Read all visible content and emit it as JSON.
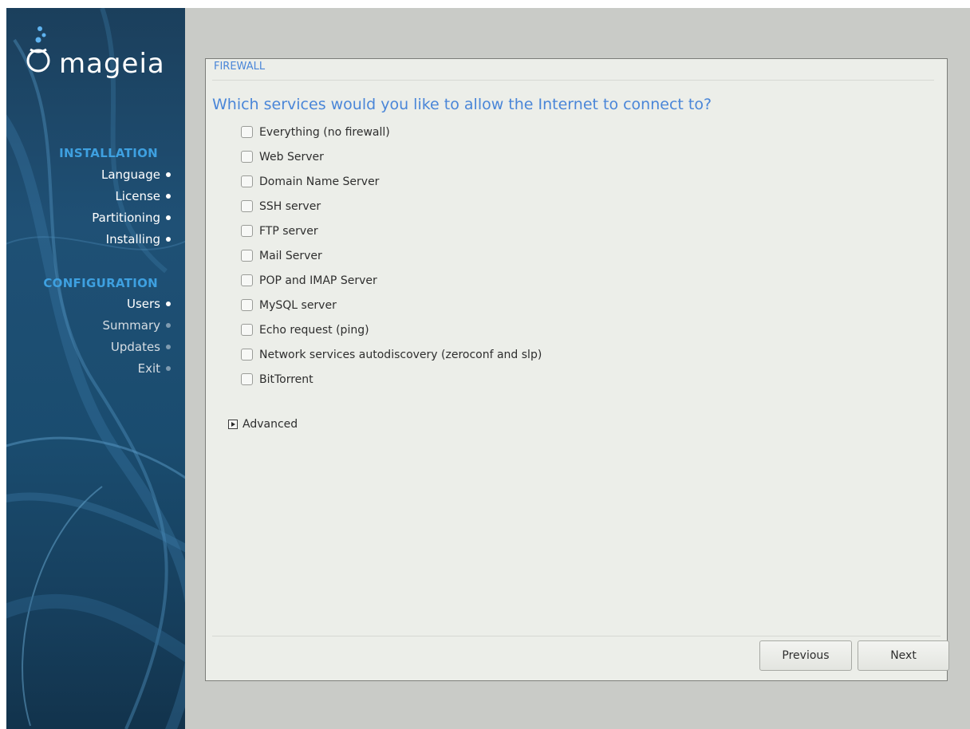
{
  "app": {
    "logo_text": "mageia"
  },
  "sidebar": {
    "installation_title": "INSTALLATION",
    "installation_steps": [
      {
        "label": "Language",
        "state": "done"
      },
      {
        "label": "License",
        "state": "done"
      },
      {
        "label": "Partitioning",
        "state": "done"
      },
      {
        "label": "Installing",
        "state": "done"
      }
    ],
    "configuration_title": "CONFIGURATION",
    "configuration_steps": [
      {
        "label": "Users",
        "state": "done"
      },
      {
        "label": "Summary",
        "state": "pending"
      },
      {
        "label": "Updates",
        "state": "pending"
      },
      {
        "label": "Exit",
        "state": "pending"
      }
    ]
  },
  "panel": {
    "header": "FIREWALL",
    "question": "Which services would you like to allow the Internet to connect to?",
    "services": [
      {
        "label": "Everything (no firewall)",
        "checked": false
      },
      {
        "label": "Web Server",
        "checked": false
      },
      {
        "label": "Domain Name Server",
        "checked": false
      },
      {
        "label": "SSH server",
        "checked": false
      },
      {
        "label": "FTP server",
        "checked": false
      },
      {
        "label": "Mail Server",
        "checked": false
      },
      {
        "label": "POP and IMAP Server",
        "checked": false
      },
      {
        "label": "MySQL server",
        "checked": false
      },
      {
        "label": "Echo request (ping)",
        "checked": false
      },
      {
        "label": "Network services autodiscovery (zeroconf and slp)",
        "checked": false
      },
      {
        "label": "BitTorrent",
        "checked": false
      }
    ],
    "advanced_label": "Advanced",
    "previous_label": "Previous",
    "next_label": "Next"
  },
  "colors": {
    "accent": "#4a86d8",
    "sidebar_title": "#3ea0e0",
    "sidebar_bg": "#1f5075",
    "panel_bg": "#eceee9"
  }
}
